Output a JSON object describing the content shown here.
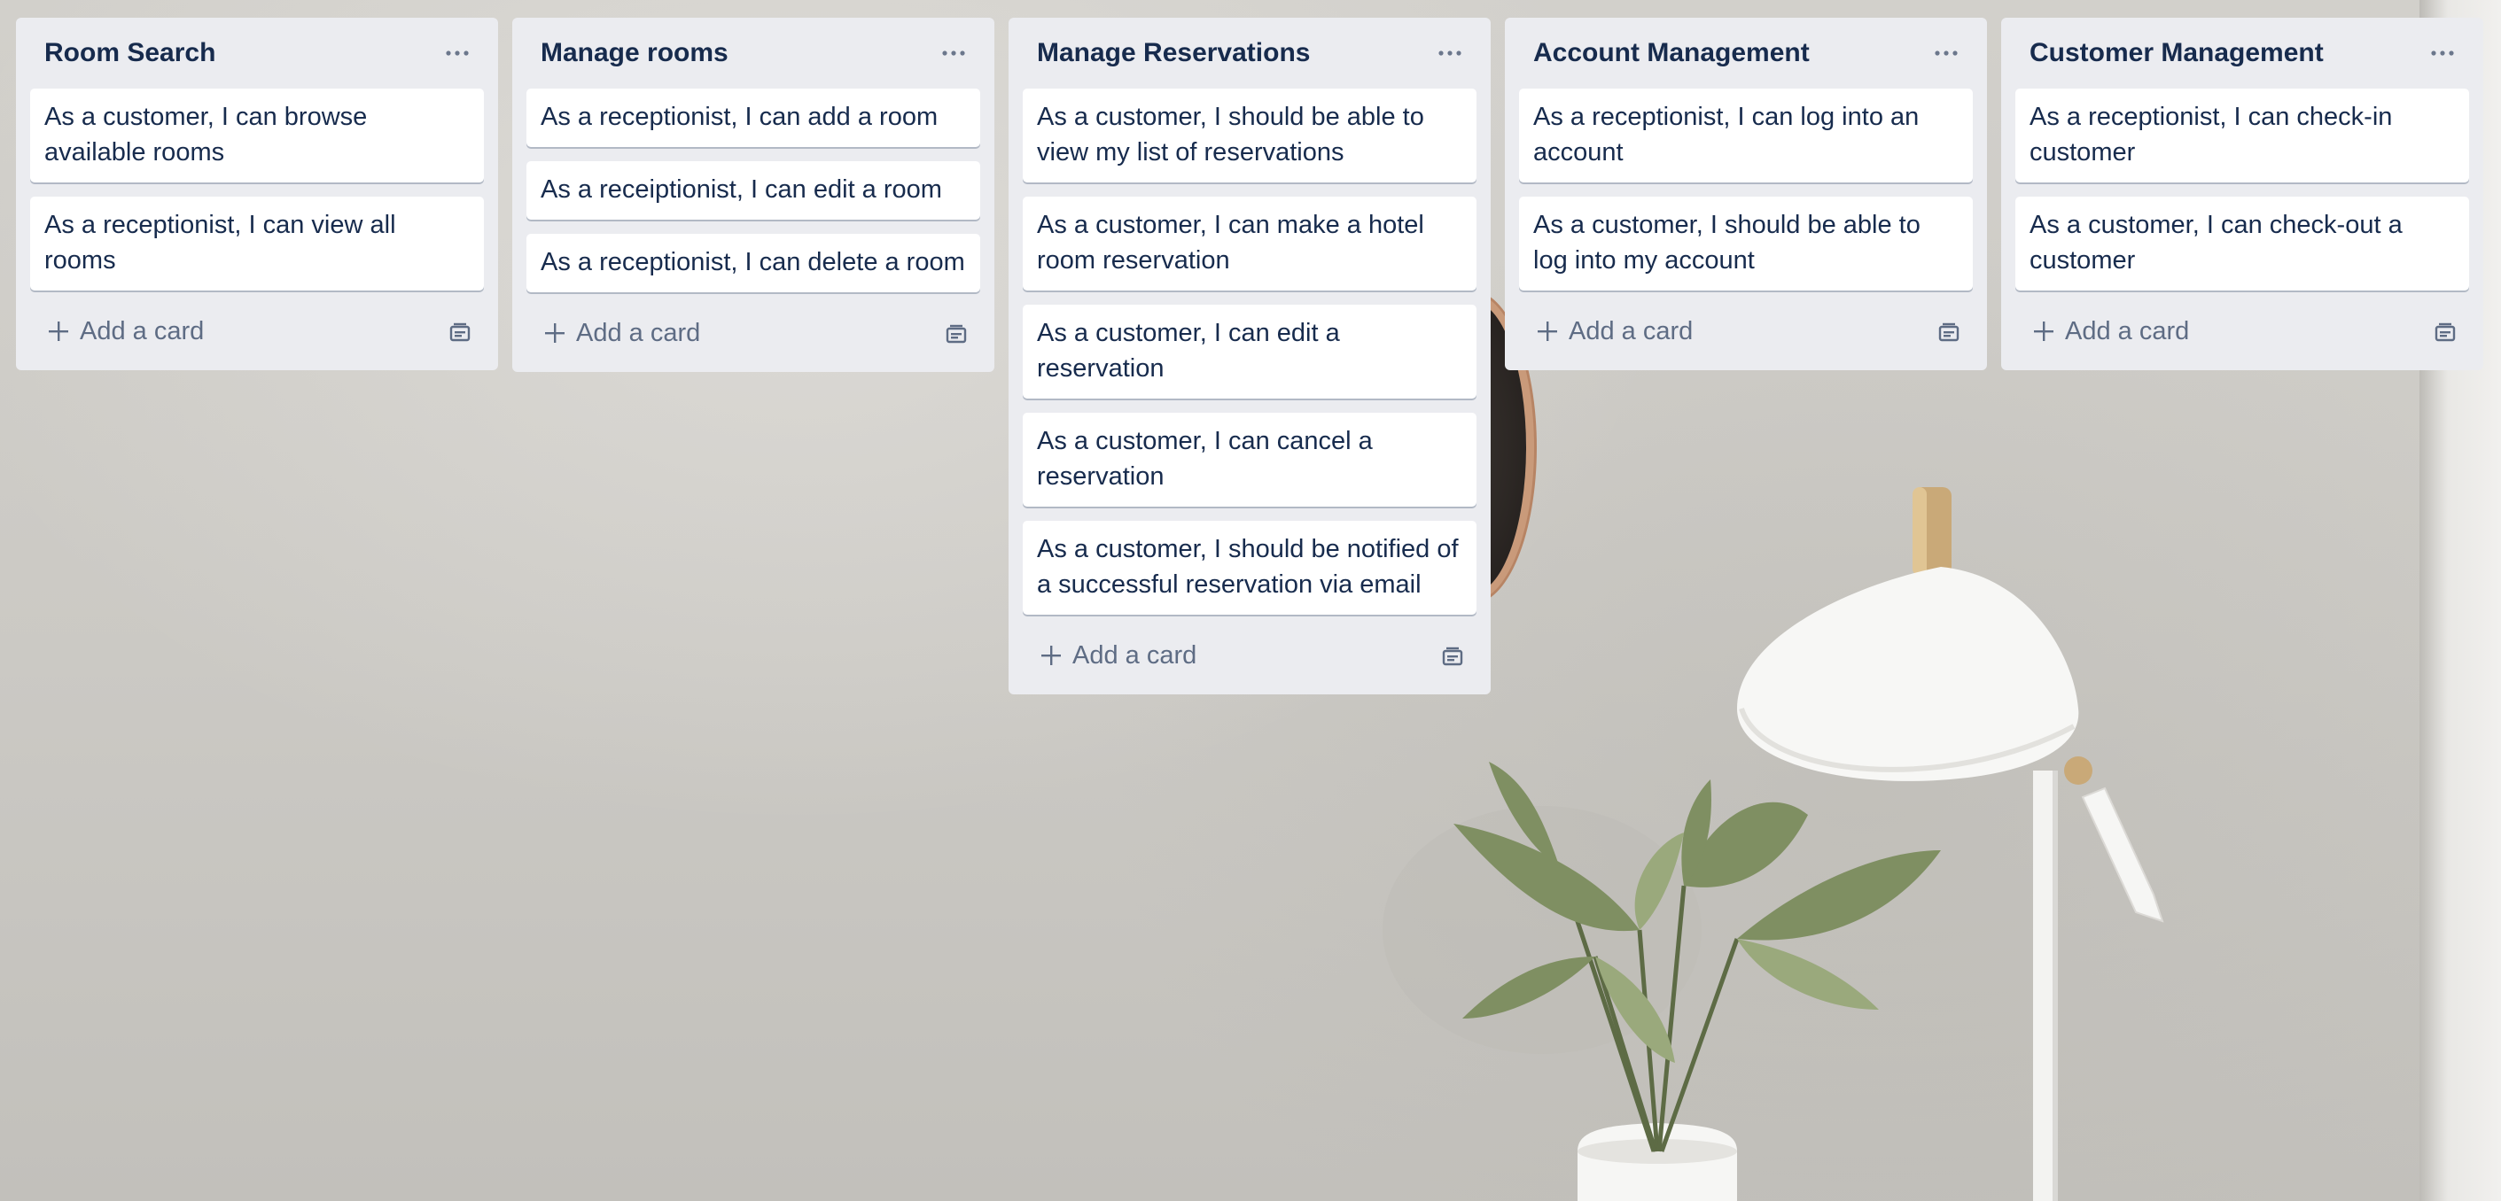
{
  "lists": [
    {
      "title": "Room Search",
      "cards": [
        "As a customer, I can browse available rooms",
        "As a receptionist, I can view all rooms"
      ],
      "add_label": "Add a card"
    },
    {
      "title": "Manage rooms",
      "cards": [
        "As a receptionist, I can add a room",
        "As a receiptionist, I can edit a room",
        "As a receptionist, I can delete a room"
      ],
      "add_label": "Add a card"
    },
    {
      "title": "Manage Reservations",
      "cards": [
        "As a customer, I should be able to view my list of reservations",
        "As a customer, I can make a hotel room reservation",
        "As a customer, I can edit a reservation",
        "As a customer, I can cancel a reservation",
        "As a customer, I should be notified of a successful reservation via email"
      ],
      "add_label": "Add a card"
    },
    {
      "title": "Account Management",
      "cards": [
        "As a receptionist, I can log into an account",
        "As a customer, I should be able to log into my account"
      ],
      "add_label": "Add a card"
    },
    {
      "title": "Customer Management",
      "cards": [
        "As a receptionist, I can check-in customer",
        "As a customer, I can check-out a customer"
      ],
      "add_label": "Add a card"
    }
  ],
  "icons": {
    "list_menu": "ellipsis-icon",
    "add": "plus-icon",
    "template": "card-template-icon"
  },
  "colors": {
    "list_bg": "#ebecf0",
    "card_bg": "#ffffff",
    "title_text": "#172b4d",
    "muted_text": "#5e6c84"
  }
}
